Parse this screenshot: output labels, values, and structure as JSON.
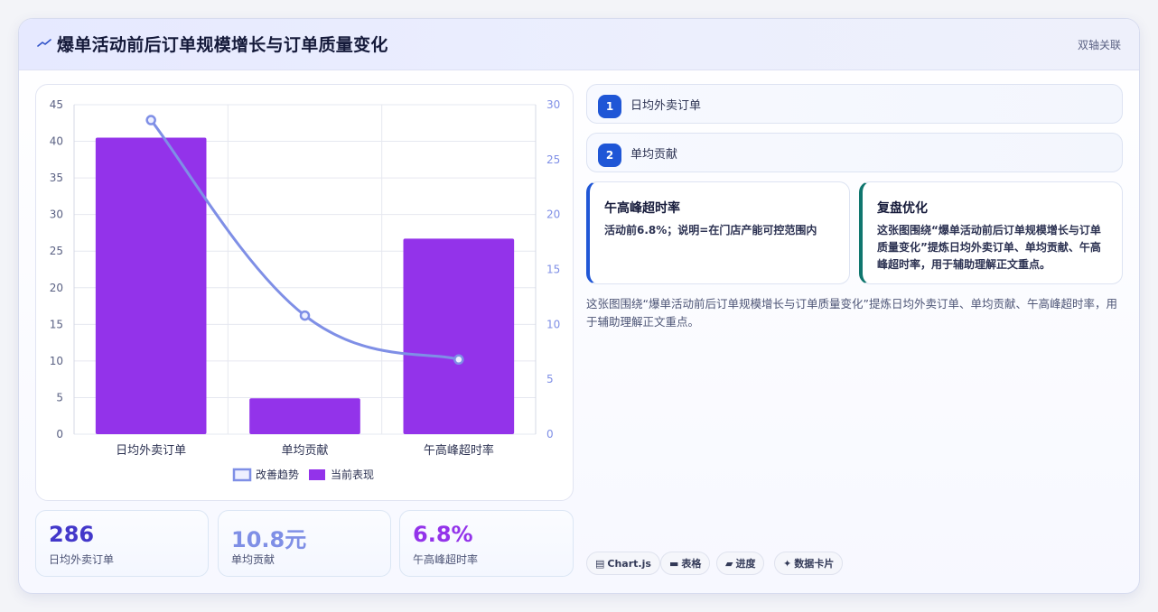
{
  "header": {
    "title": "爆单活动前后订单规模增长与订单质量变化",
    "tag": "双轴关联"
  },
  "colors": {
    "bar": "#9333ea",
    "line": "#7f8fe6",
    "accent_blue": "#1f56d6",
    "accent_teal": "#0f766e",
    "stat1": "#4338ca",
    "stat2": "#7f8fe6",
    "stat3": "#9333ea"
  },
  "chart_data": {
    "type": "bar",
    "categories": [
      "日均外卖订单",
      "单均贡献",
      "午高峰超时率"
    ],
    "series": [
      {
        "name": "改善趋势",
        "type": "line",
        "axis": "right",
        "values": [
          28.6,
          10.8,
          6.8
        ]
      },
      {
        "name": "当前表现",
        "type": "bar",
        "axis": "left",
        "values": [
          40.5,
          4.9,
          26.7
        ]
      }
    ],
    "y_left": {
      "min": 0,
      "max": 45,
      "ticks": [
        "0",
        "5",
        "10",
        "15",
        "20",
        "25",
        "30",
        "35",
        "40",
        "45"
      ]
    },
    "y_right": {
      "min": 0,
      "max": 30,
      "ticks": [
        "0",
        "5",
        "10",
        "15",
        "20",
        "25",
        "30"
      ]
    },
    "grid": true,
    "legend": "bottom"
  },
  "stats": [
    {
      "value": "286",
      "label": "日均外卖订单"
    },
    {
      "value": "10.8元",
      "label": "单均贡献"
    },
    {
      "value": "6.8%",
      "label": "午高峰超时率"
    }
  ],
  "list": [
    {
      "num": "1",
      "label": "日均外卖订单"
    },
    {
      "num": "2",
      "label": "单均贡献"
    }
  ],
  "cards": [
    {
      "title": "午高峰超时率",
      "body": "活动前6.8%；说明=在门店产能可控范围内"
    },
    {
      "title": "复盘优化",
      "body": "这张图围绕“爆单活动前后订单规模增长与订单质量变化”提炼日均外卖订单、单均贡献、午高峰超时率，用于辅助理解正文重点。"
    }
  ],
  "description": "这张图围绕“爆单活动前后订单规模增长与订单质量变化”提炼日均外卖订单、单均贡献、午高峰超时率，用于辅助理解正文重点。",
  "chips": [
    {
      "icon": "chart-icon",
      "label": "Chart.js"
    },
    {
      "icon": "table-icon",
      "label": "表格"
    },
    {
      "icon": "progress-icon",
      "label": "进度"
    },
    {
      "icon": "sparkle-icon",
      "label": "数据卡片"
    }
  ]
}
